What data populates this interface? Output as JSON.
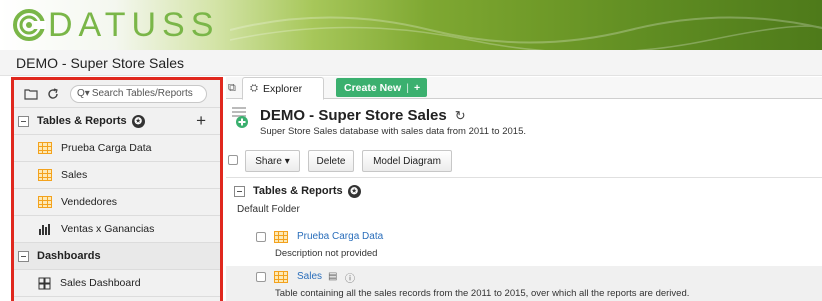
{
  "brand": {
    "logo_text": "DATUSS"
  },
  "app_title": "DEMO - Super Store Sales",
  "sidebar": {
    "search_placeholder": "Search Tables/Reports",
    "section_tables": "Tables & Reports",
    "items": [
      {
        "label": "Prueba Carga Data",
        "icon": "table-icon"
      },
      {
        "label": "Sales",
        "icon": "table-icon"
      },
      {
        "label": "Vendedores",
        "icon": "table-icon"
      },
      {
        "label": "Ventas x Ganancias",
        "icon": "bar-chart-icon"
      }
    ],
    "section_dashboards": "Dashboards",
    "dashboards": [
      {
        "label": "Sales Dashboard",
        "icon": "dashboard-grid-icon"
      }
    ],
    "highlight_color": "#e0281e"
  },
  "tabs": {
    "explorer": "Explorer",
    "create_new": "Create New"
  },
  "database": {
    "title": "DEMO - Super Store Sales",
    "description": "Super Store Sales database with sales data from 2011 to 2015."
  },
  "toolbar": {
    "share": "Share",
    "delete": "Delete",
    "model_diagram": "Model Diagram"
  },
  "content": {
    "section_title": "Tables & Reports",
    "folder_label": "Default Folder",
    "rows": [
      {
        "name": "Prueba Carga Data",
        "description": "Description not provided"
      },
      {
        "name": "Sales",
        "description": "Table containing all the sales records from the 2011 to 2015, over which all the reports are derived."
      }
    ]
  },
  "colors": {
    "accent_green": "#3bb06f",
    "link_blue": "#2a6ebb",
    "table_icon_orange": "#f3a21d"
  }
}
